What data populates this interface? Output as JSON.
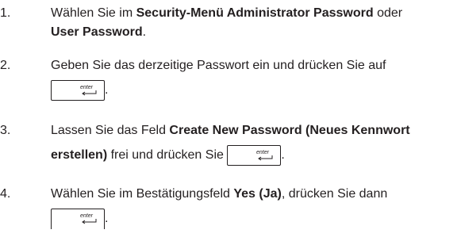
{
  "enter_key": {
    "label": "enter",
    "icon": "enter-key-icon"
  },
  "steps": [
    {
      "number": "1.",
      "line1_prefix": "Wählen Sie im ",
      "line1_bold": "Security-Menü Administrator Password",
      "line1_suffix": " oder",
      "line2_bold": "User Password",
      "line2_suffix": "."
    },
    {
      "number": "2.",
      "text": "Geben Sie das derzeitige Passwort ein und drücken Sie auf",
      "after_key": "."
    },
    {
      "number": "3.",
      "line1_prefix": "Lassen Sie das Feld ",
      "line1_bold": "Create New Password (Neues Kennwort",
      "line2_bold": "erstellen)",
      "line2_suffix": " frei und drücken Sie ",
      "after_key": "."
    },
    {
      "number": "4.",
      "text_prefix": "Wählen Sie im Bestätigungsfeld ",
      "text_bold": "Yes (Ja)",
      "text_suffix": ", drücken Sie dann",
      "after_key": "."
    }
  ]
}
